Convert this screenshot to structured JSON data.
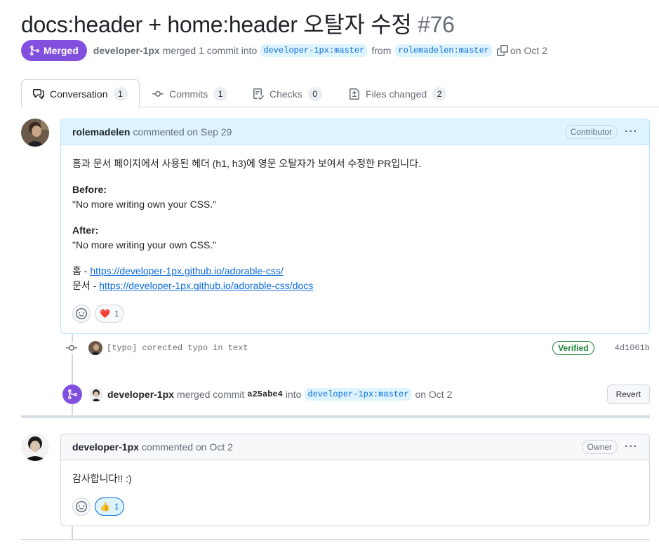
{
  "pr": {
    "title": "docs:header + home:header 오탈자 수정",
    "number": "#76",
    "status": "Merged",
    "merger": "developer-1px",
    "merge_text": "merged 1 commit into",
    "base_branch": "developer-1px:master",
    "from_text": "from",
    "head_branch": "rolemadelen:master",
    "date_text": "on Oct 2"
  },
  "tabs": [
    {
      "label": "Conversation",
      "count": "1"
    },
    {
      "label": "Commits",
      "count": "1"
    },
    {
      "label": "Checks",
      "count": "0"
    },
    {
      "label": "Files changed",
      "count": "2"
    }
  ],
  "comment1": {
    "author": "rolemadelen",
    "action": "commented on Sep 29",
    "role": "Contributor",
    "more": "···",
    "intro": "홈과 문서 페이지에서 사용된 헤더 (h1, h3)에 영문 오탈자가 보여서 수정한 PR입니다.",
    "before_label": "Before:",
    "before_text": "\"No more writing own your CSS.\"",
    "after_label": "After:",
    "after_text": "\"No more writing your own CSS.\"",
    "link1_prefix": "홈 - ",
    "link1": "https://developer-1px.github.io/adorable-css/",
    "link2_prefix": "문서 - ",
    "link2": "https://developer-1px.github.io/adorable-css/docs",
    "reaction_emoji": "❤️",
    "reaction_count": "1"
  },
  "commit": {
    "message": "[typo] corected typo in text",
    "verified": "Verified",
    "sha": "4d1061b"
  },
  "merge_event": {
    "author": "developer-1px",
    "text1": "merged commit",
    "sha": "a25abe4",
    "text2": "into",
    "branch": "developer-1px:master",
    "date": "on Oct 2",
    "revert_label": "Revert"
  },
  "comment2": {
    "author": "developer-1px",
    "action": "commented on Oct 2",
    "role": "Owner",
    "more": "···",
    "body": "감사합니다!! :)",
    "reaction_emoji": "👍",
    "reaction_count": "1"
  },
  "colors": {
    "merged": "#8250df",
    "link": "#0969da",
    "verified": "#1a7f37",
    "author_header": "#ddf4ff"
  }
}
